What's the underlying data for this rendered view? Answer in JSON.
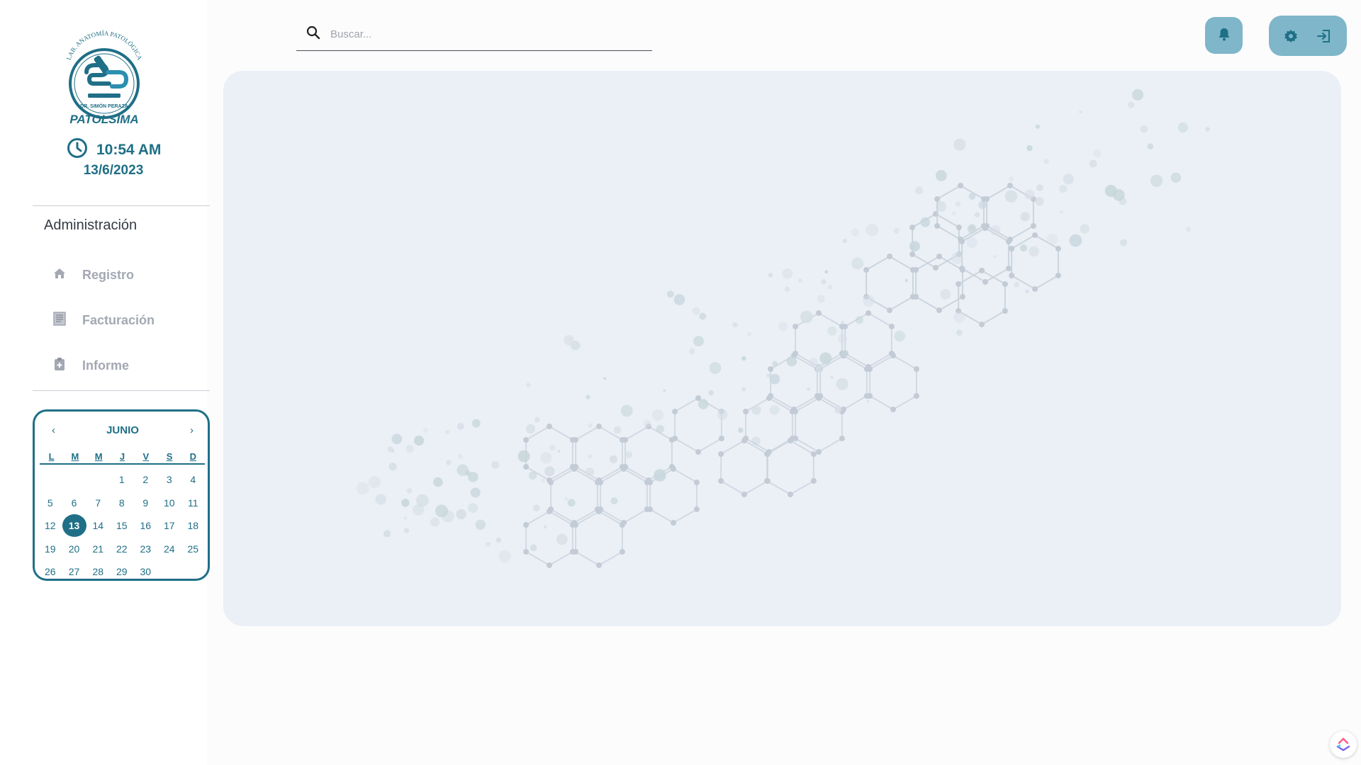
{
  "logo": {
    "arc_text": "LAB. ANATOMÍA PATOLÓGICA",
    "doctor": "DR. SIMÓN PERAZA",
    "brand": "PATOLSIMA"
  },
  "clock": {
    "time": "10:54 AM",
    "date": "13/6/2023"
  },
  "sidebar": {
    "section_title": "Administración",
    "items": [
      {
        "label": "Registro",
        "icon": "home-icon"
      },
      {
        "label": "Facturación",
        "icon": "document-icon"
      },
      {
        "label": "Informe",
        "icon": "clipboard-plus-icon"
      }
    ]
  },
  "calendar": {
    "prev": "‹",
    "next": "›",
    "month": "JUNIO",
    "weekdays": [
      "L",
      "M",
      "M",
      "J",
      "V",
      "S",
      "D"
    ],
    "days": [
      "",
      "",
      "",
      "1",
      "2",
      "3",
      "4",
      "5",
      "6",
      "7",
      "8",
      "9",
      "10",
      "11",
      "12",
      "13",
      "14",
      "15",
      "16",
      "17",
      "18",
      "19",
      "20",
      "21",
      "22",
      "23",
      "24",
      "25",
      "26",
      "27",
      "28",
      "29",
      "30",
      "",
      ""
    ],
    "today": "13"
  },
  "search": {
    "placeholder": "Buscar...",
    "value": ""
  },
  "header": {
    "buttons": [
      "bell-icon",
      "gear-icon",
      "logout-icon"
    ]
  },
  "colors": {
    "accent": "#1f6f86",
    "button_bg": "#7fb6c9",
    "panel_bg": "#ebf0f6",
    "nav_text": "#a3a8b3"
  }
}
